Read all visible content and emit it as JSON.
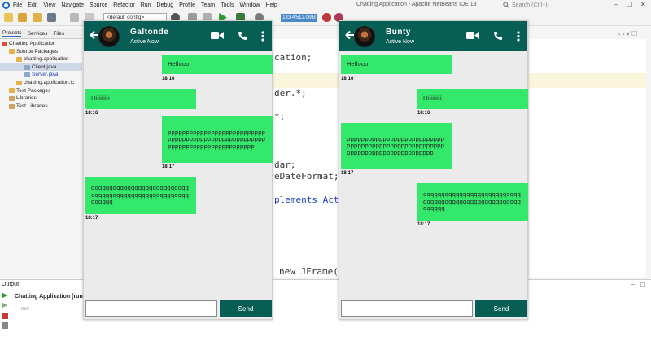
{
  "ide": {
    "menu": [
      "File",
      "Edit",
      "View",
      "Navigate",
      "Source",
      "Refactor",
      "Run",
      "Debug",
      "Profile",
      "Team",
      "Tools",
      "Window",
      "Help"
    ],
    "title": "Chatting Application - Apache NetBeans IDE 13",
    "search_placeholder": "Search (Ctrl+I)",
    "config": "<default config>",
    "memory": "133.4/512.0MB",
    "project_tabs": [
      "Projects",
      "Services",
      "Files"
    ],
    "tree": [
      {
        "label": "Chatting Application",
        "indent": 0
      },
      {
        "label": "Source Packages",
        "indent": 1
      },
      {
        "label": "chatting.application",
        "indent": 2
      },
      {
        "label": "Client.java",
        "indent": 3
      },
      {
        "label": "Server.java",
        "indent": 3
      },
      {
        "label": "chatting.application.ic",
        "indent": 2
      },
      {
        "label": "Test Packages",
        "indent": 1
      },
      {
        "label": "Libraries",
        "indent": 1
      },
      {
        "label": "Test Libraries",
        "indent": 1
      }
    ],
    "code_lines": [
      "cation;",
      "der.*;",
      "*;",
      "dar;",
      "eDateFormat;i",
      "plements Acti",
      "new JFrame()"
    ],
    "output": {
      "title": "Output",
      "tab": "Chatting Application (run)",
      "line": "run:"
    }
  },
  "chats": [
    {
      "name": "Galtonde",
      "status": "Active Now",
      "send_label": "Send",
      "input_value": "",
      "messages": [
        {
          "text": "Hellooo",
          "time": "18:16",
          "side": "right"
        },
        {
          "text": "Hiiiiiiiii",
          "time": "18:16",
          "side": "left"
        },
        {
          "text": "pppppppppppppppppppppppppppppppppppppppppppppppppppppppppppppppppppppppppppppp",
          "time": "18:17",
          "side": "right"
        },
        {
          "text": "qqqqqqqqqqqqqqqqqqqqqqqqqqqqqqqqqqqqqqqqqqqqqqqqqqqqqqqqqqqq",
          "time": "18:17",
          "side": "left"
        }
      ]
    },
    {
      "name": "Bunty",
      "status": "Active Now",
      "send_label": "Send",
      "input_value": "",
      "messages": [
        {
          "text": "Hellooo",
          "time": "18:16",
          "side": "left"
        },
        {
          "text": "Hiiiiiiiii",
          "time": "18:16",
          "side": "right"
        },
        {
          "text": "pppppppppppppppppppppppppppppppppppppppppppppppppppppppppppppppppppppppppppppp",
          "time": "18:17",
          "side": "left"
        },
        {
          "text": "qqqqqqqqqqqqqqqqqqqqqqqqqqqqqqqqqqqqqqqqqqqqqqqqqqqqqqqqqqqq",
          "time": "18:17",
          "side": "right"
        }
      ]
    }
  ],
  "colors": {
    "header": "#075e54",
    "bubble": "#33e86b",
    "chat_bg": "#ebebeb"
  }
}
